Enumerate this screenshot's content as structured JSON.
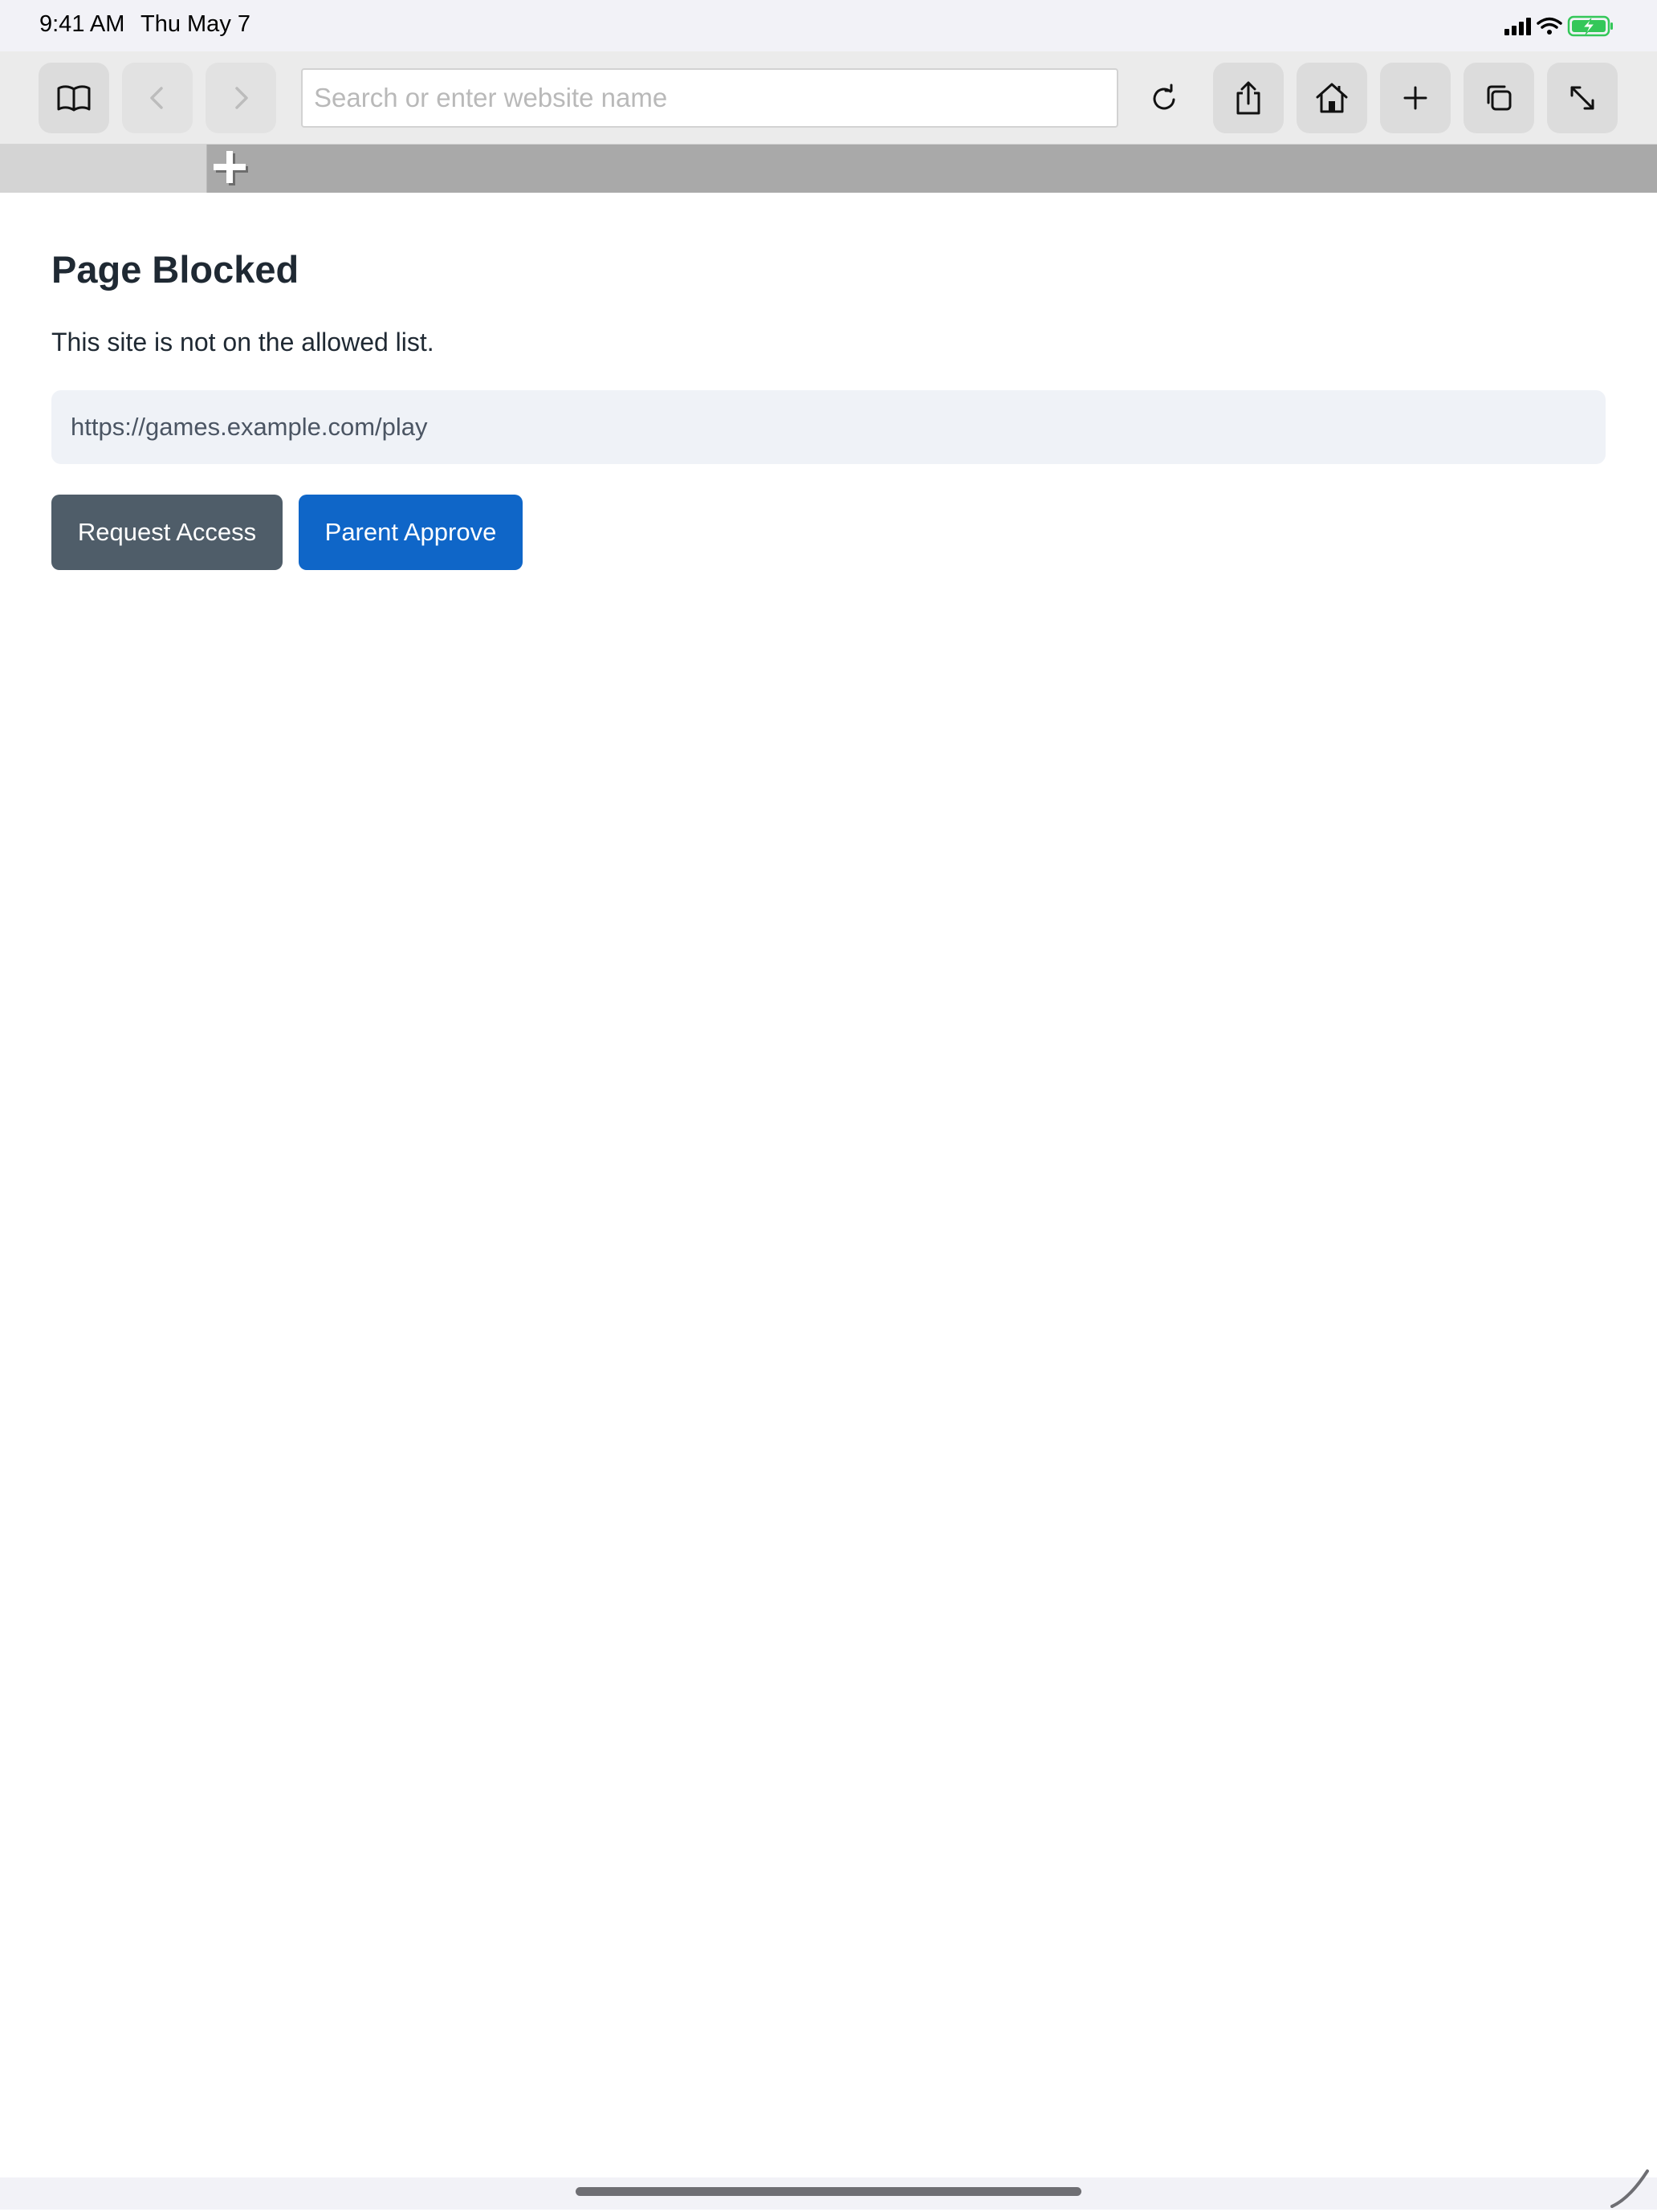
{
  "status_bar": {
    "time": "9:41 AM",
    "date": "Thu May 7"
  },
  "toolbar": {
    "url_placeholder": "Search or enter website name",
    "url_value": "",
    "icons": [
      "bookmarks-icon",
      "back-icon",
      "forward-icon",
      "reload-icon",
      "share-icon",
      "home-icon",
      "new-tab-icon",
      "tabs-icon",
      "fullscreen-icon"
    ]
  },
  "page": {
    "title": "Page Blocked",
    "message": "This site is not on the allowed list.",
    "blocked_url": "https://games.example.com/play",
    "request_button": "Request Access",
    "approve_button": "Parent Approve"
  },
  "colors": {
    "request_button": "#4f5d69",
    "approve_button": "#0f66c8",
    "url_box_bg": "#eff2f7",
    "battery_green": "#34c759"
  }
}
